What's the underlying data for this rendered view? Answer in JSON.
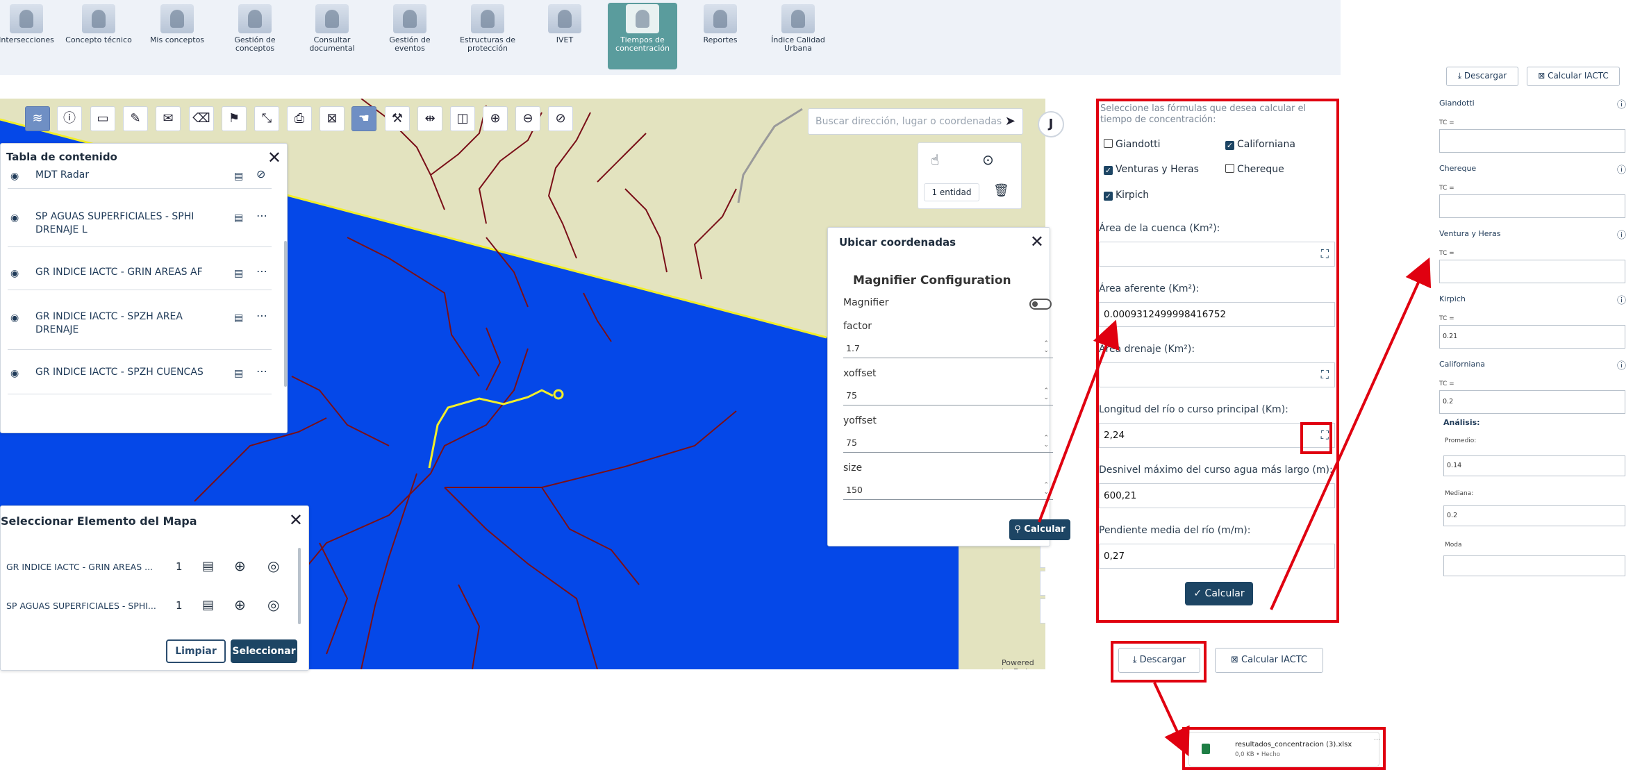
{
  "topbar": {
    "items": [
      {
        "label": "Intersecciones",
        "icon": "intersection-icon"
      },
      {
        "label": "Concepto técnico",
        "icon": "technician-icon"
      },
      {
        "label": "Mis conceptos",
        "icon": "people-icon"
      },
      {
        "label": "Gestión de conceptos",
        "icon": "document-manage-icon"
      },
      {
        "label": "Consultar documental",
        "icon": "document-search-icon"
      },
      {
        "label": "Gestión de eventos",
        "icon": "mountain-events-icon"
      },
      {
        "label": "Estructuras de protección",
        "icon": "structure-icon"
      },
      {
        "label": "IVET",
        "icon": "ivet-icon"
      },
      {
        "label": "Tiempos de concentración",
        "icon": "stopwatch-icon",
        "active": true
      },
      {
        "label": "Reportes",
        "icon": "reports-icon"
      },
      {
        "label": "Índice Calidad Urbana",
        "icon": "urban-quality-icon"
      }
    ]
  },
  "map": {
    "search_placeholder": "Buscar dirección, lugar o coordenadas",
    "user_initial": "J",
    "selection_count": "1 entidad",
    "attribution": "Powered by Esri",
    "colors": {
      "land": "#e3e3bf",
      "water": "#0548e8",
      "rivers": "#7a0f18",
      "highlight": "#f2ef2a"
    }
  },
  "toc": {
    "title": "Tabla de contenido",
    "items": [
      "MDT Radar",
      "SP AGUAS SUPERFICIALES - SPHI DRENAJE L",
      "GR INDICE IACTC - GRIN AREAS AF",
      "GR INDICE IACTC - SPZH AREA DRENAJE",
      "GR INDICE IACTC - SPZH CUENCAS"
    ]
  },
  "select_map": {
    "title": "Seleccionar Elemento del Mapa",
    "rows": [
      {
        "name": "GR INDICE IACTC - GRIN AREAS ...",
        "count": "1"
      },
      {
        "name": "SP AGUAS SUPERFICIALES - SPHI...",
        "count": "1"
      }
    ],
    "clear_label": "Limpiar",
    "select_label": "Seleccionar"
  },
  "ubicar": {
    "title": "Ubicar coordenadas",
    "subtitle": "Magnifier Configuration",
    "magnifier_label": "Magnifier",
    "fields": [
      {
        "label": "factor",
        "value": "1.7"
      },
      {
        "label": "xoffset",
        "value": "75"
      },
      {
        "label": "yoffset",
        "value": "75"
      },
      {
        "label": "size",
        "value": "150"
      }
    ],
    "calc_label": "Calcular"
  },
  "form": {
    "intro": "Seleccione las fórmulas que desea calcular el tiempo de concentración:",
    "formulas": [
      {
        "label": "Giandotti",
        "checked": false
      },
      {
        "label": "Californiana",
        "checked": true
      },
      {
        "label": "Venturas y Heras",
        "checked": true
      },
      {
        "label": "Chereque",
        "checked": false
      },
      {
        "label": "Kirpich",
        "checked": true
      }
    ],
    "fields": [
      {
        "label": "Área de la cuenca (Km²):",
        "value": "",
        "picker": true
      },
      {
        "label": "Área aferente (Km²):",
        "value": "0.0009312499998416752",
        "picker": false
      },
      {
        "label": "Área drenaje (Km²):",
        "value": "",
        "picker": true
      },
      {
        "label": "Longitud del río o curso principal (Km):",
        "value": "2,24",
        "picker": true
      },
      {
        "label": "Desnivel máximo del curso agua más largo (m):",
        "value": "600,21",
        "picker": false
      },
      {
        "label": "Pendiente media del río (m/m):",
        "value": "0,27",
        "picker": false
      }
    ],
    "submit_label": "✓ Calcular"
  },
  "actions": {
    "download_label": "Descargar",
    "calc_iactc_label": "Calcular IACTC"
  },
  "results": {
    "download_label": "Descargar",
    "calc_iactc_label": "Calcular IACTC",
    "tc_label": "TC =",
    "formulas": [
      {
        "name": "Giandotti",
        "value": ""
      },
      {
        "name": "Chereque",
        "value": ""
      },
      {
        "name": "Ventura y Heras",
        "value": ""
      },
      {
        "name": "Kirpich",
        "value": "0.21"
      },
      {
        "name": "Californiana",
        "value": "0.2"
      }
    ],
    "analysis_title": "Análisis:",
    "stats": [
      {
        "name": "Promedio:",
        "value": "0.14"
      },
      {
        "name": "Mediana:",
        "value": "0.2"
      },
      {
        "name": "Moda",
        "value": ""
      }
    ]
  },
  "download_popup": {
    "filename": "resultados_concentracion (3).xlsx",
    "meta": "0,0 KB • Hecho"
  },
  "annotation_color": "#e00010"
}
